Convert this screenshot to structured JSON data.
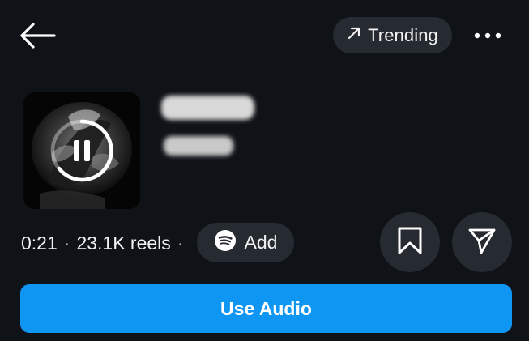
{
  "header": {
    "back_icon": "arrow-left-icon",
    "trending": {
      "icon": "arrow-up-right-icon",
      "label": "Trending"
    },
    "more_icon": "more-horizontal-icon"
  },
  "track": {
    "cover_state": "playing",
    "control_icon": "pause-icon",
    "title_redacted": true,
    "artist_redacted": true
  },
  "meta": {
    "duration": "0:21",
    "separator": "·",
    "reels_count": "23.1K reels",
    "trailing_separator": "·"
  },
  "spotify": {
    "icon": "spotify-icon",
    "label": "Add"
  },
  "actions": {
    "save_icon": "bookmark-icon",
    "share_icon": "send-icon"
  },
  "primary_action": {
    "label": "Use Audio"
  },
  "colors": {
    "background": "#0f1217",
    "pill": "#262a31",
    "accent": "#0f95f2",
    "text": "#ffffff"
  }
}
